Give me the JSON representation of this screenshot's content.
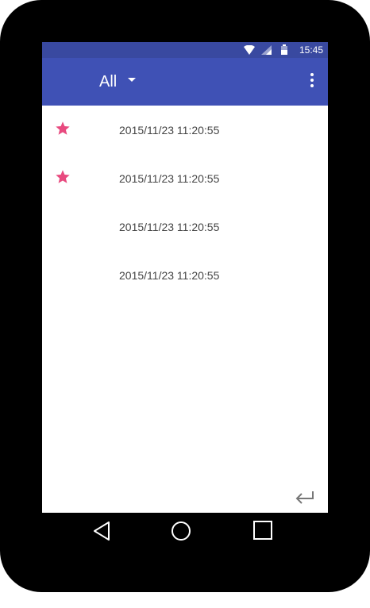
{
  "status_bar": {
    "time": "15:45",
    "icons": [
      "wifi-icon",
      "signal-icon",
      "battery-icon"
    ]
  },
  "app_bar": {
    "filter_label": "All",
    "icons": [
      "dropdown-arrow-icon",
      "overflow-menu-icon"
    ]
  },
  "list": {
    "items": [
      {
        "timestamp": "2015/11/23 11:20:55",
        "starred": true
      },
      {
        "timestamp": "2015/11/23 11:20:55",
        "starred": true
      },
      {
        "timestamp": "2015/11/23 11:20:55",
        "starred": false
      },
      {
        "timestamp": "2015/11/23 11:20:55",
        "starred": false
      }
    ]
  },
  "actions": {
    "back_icon": "return-arrow-icon"
  },
  "nav_bar": {
    "icons": [
      "back-triangle-icon",
      "home-circle-icon",
      "recents-square-icon"
    ]
  },
  "colors": {
    "primary": "#3f51b5",
    "primary_dark": "#3949a0",
    "star": "#e84a7f",
    "text": "#444444"
  }
}
